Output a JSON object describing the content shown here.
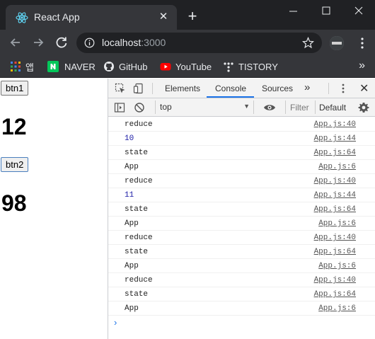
{
  "browser": {
    "tab_title": "React App",
    "url_host": "localhost",
    "url_port": ":3000",
    "bookmarks": [
      {
        "label": "앱",
        "icon": "apps-grid-icon"
      },
      {
        "label": "NAVER",
        "icon": "naver-icon"
      },
      {
        "label": "GitHub",
        "icon": "github-icon"
      },
      {
        "label": "YouTube",
        "icon": "youtube-icon"
      },
      {
        "label": "TISTORY",
        "icon": "tistory-icon"
      }
    ],
    "bookmarks_more": "»"
  },
  "page": {
    "btn1_label": "btn1",
    "count1": "12",
    "btn2_label": "btn2",
    "count2": "98"
  },
  "devtools": {
    "tabs": [
      "Elements",
      "Console",
      "Sources"
    ],
    "active_tab": "Console",
    "more_tabs": "»",
    "context": "top",
    "filter_placeholder": "Filter",
    "levels": "Default",
    "logs": [
      {
        "msg": "reduce",
        "src": "App.js:40",
        "type": "text"
      },
      {
        "msg": "10",
        "src": "App.js:44",
        "type": "num"
      },
      {
        "msg": "state",
        "src": "App.js:64",
        "type": "text"
      },
      {
        "msg": "App",
        "src": "App.js:6",
        "type": "text"
      },
      {
        "msg": "reduce",
        "src": "App.js:40",
        "type": "text"
      },
      {
        "msg": "11",
        "src": "App.js:44",
        "type": "num"
      },
      {
        "msg": "state",
        "src": "App.js:64",
        "type": "text"
      },
      {
        "msg": "App",
        "src": "App.js:6",
        "type": "text"
      },
      {
        "msg": "reduce",
        "src": "App.js:40",
        "type": "text"
      },
      {
        "msg": "state",
        "src": "App.js:64",
        "type": "text"
      },
      {
        "msg": "App",
        "src": "App.js:6",
        "type": "text"
      },
      {
        "msg": "reduce",
        "src": "App.js:40",
        "type": "text"
      },
      {
        "msg": "state",
        "src": "App.js:64",
        "type": "text"
      },
      {
        "msg": "App",
        "src": "App.js:6",
        "type": "text"
      }
    ],
    "prompt": "›"
  },
  "colors": {
    "chrome_dark": "#202124",
    "chrome_toolbar": "#35363a",
    "react_blue": "#61dafb",
    "devtools_accent": "#1a73e8",
    "console_number": "#1a1aa6"
  }
}
